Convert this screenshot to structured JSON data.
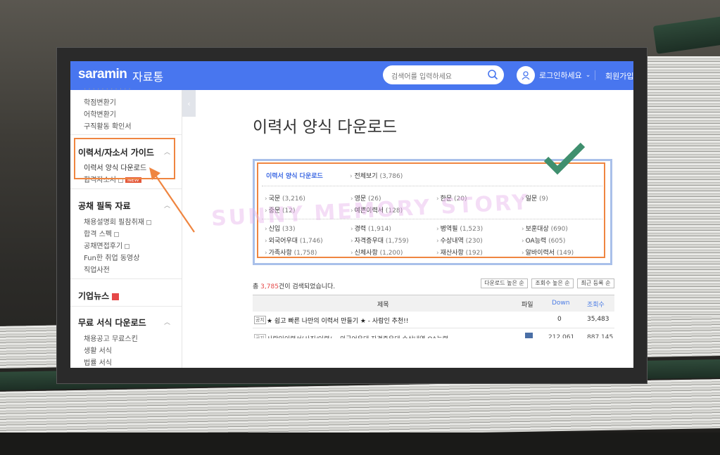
{
  "header": {
    "logo": "saramin",
    "logo_sub": "자료통",
    "search_placeholder": "검색어를 입력하세요",
    "login_label": "로그인하세요",
    "join_label": "회원가입"
  },
  "sidebar": {
    "top_links": [
      "학점변환기",
      "어학변환기",
      "구직활동 확인서"
    ],
    "sections": [
      {
        "title": "이력서/자소서 가이드",
        "items": [
          "이력서 양식 다운로드",
          "합격자소서"
        ]
      },
      {
        "title": "공채 필독 자료",
        "items": [
          "채용설명회 필참취재",
          "합격 스펙",
          "공채면접후기",
          "Fun한 취업 동영상",
          "직업사전"
        ]
      },
      {
        "title": "기업뉴스",
        "items": []
      },
      {
        "title": "무료 서식 다운로드",
        "items": [
          "채용공고 무료스킨",
          "생활 서식",
          "법률 서식"
        ]
      }
    ],
    "new_badge": "NEW"
  },
  "main": {
    "page_title": "이력서 양식 다운로드",
    "category": {
      "selected": "이력서 양식 다운로드",
      "all_label": "전체보기",
      "all_count": "(3,786)",
      "group1": [
        {
          "label": "국문",
          "count": "(3,216)"
        },
        {
          "label": "영문",
          "count": "(26)"
        },
        {
          "label": "한문",
          "count": "(20)"
        },
        {
          "label": "일문",
          "count": "(9)"
        },
        {
          "label": "중문",
          "count": "(12)"
        },
        {
          "label": "예쁜이력서",
          "count": "(128)"
        }
      ],
      "group2": [
        {
          "label": "신입",
          "count": "(33)"
        },
        {
          "label": "경력",
          "count": "(1,914)"
        },
        {
          "label": "병역필",
          "count": "(1,523)"
        },
        {
          "label": "보훈대상",
          "count": "(690)"
        },
        {
          "label": "외국어우대",
          "count": "(1,746)"
        },
        {
          "label": "자격증우대",
          "count": "(1,759)"
        },
        {
          "label": "수상내역",
          "count": "(230)"
        },
        {
          "label": "OA능력",
          "count": "(605)"
        },
        {
          "label": "가족사항",
          "count": "(1,758)"
        },
        {
          "label": "신체사항",
          "count": "(1,200)"
        },
        {
          "label": "재산사항",
          "count": "(192)"
        },
        {
          "label": "알바이력서",
          "count": "(149)"
        }
      ]
    },
    "results": {
      "prefix": "총 ",
      "count": "3,785",
      "suffix": "건이 검색되었습니다.",
      "sort_buttons": [
        "다운로드 높은 순",
        "조회수 높은 순",
        "최근 등록 순"
      ]
    },
    "table": {
      "headers": {
        "title": "제목",
        "file": "파일",
        "down": "Down",
        "views": "조회수"
      },
      "rows": [
        {
          "tag": "공지",
          "title": "★ 쉽고 빠른 나만의 이력서 만들기 ★ - 사람인 추천!!",
          "down": "0",
          "views": "35,483"
        },
        {
          "tag": "공지",
          "title": "사람인이력서(사진/이력/... 외국어우대 자격증우대 수상내역 OA능력",
          "down": "212,061",
          "views": "887,145"
        }
      ]
    }
  },
  "watermark": "SUNNY MEMORY STORY",
  "colors": {
    "brand": "#4876ef",
    "annotation_orange": "#ef8540",
    "checkmark": "#3f8f6e"
  }
}
